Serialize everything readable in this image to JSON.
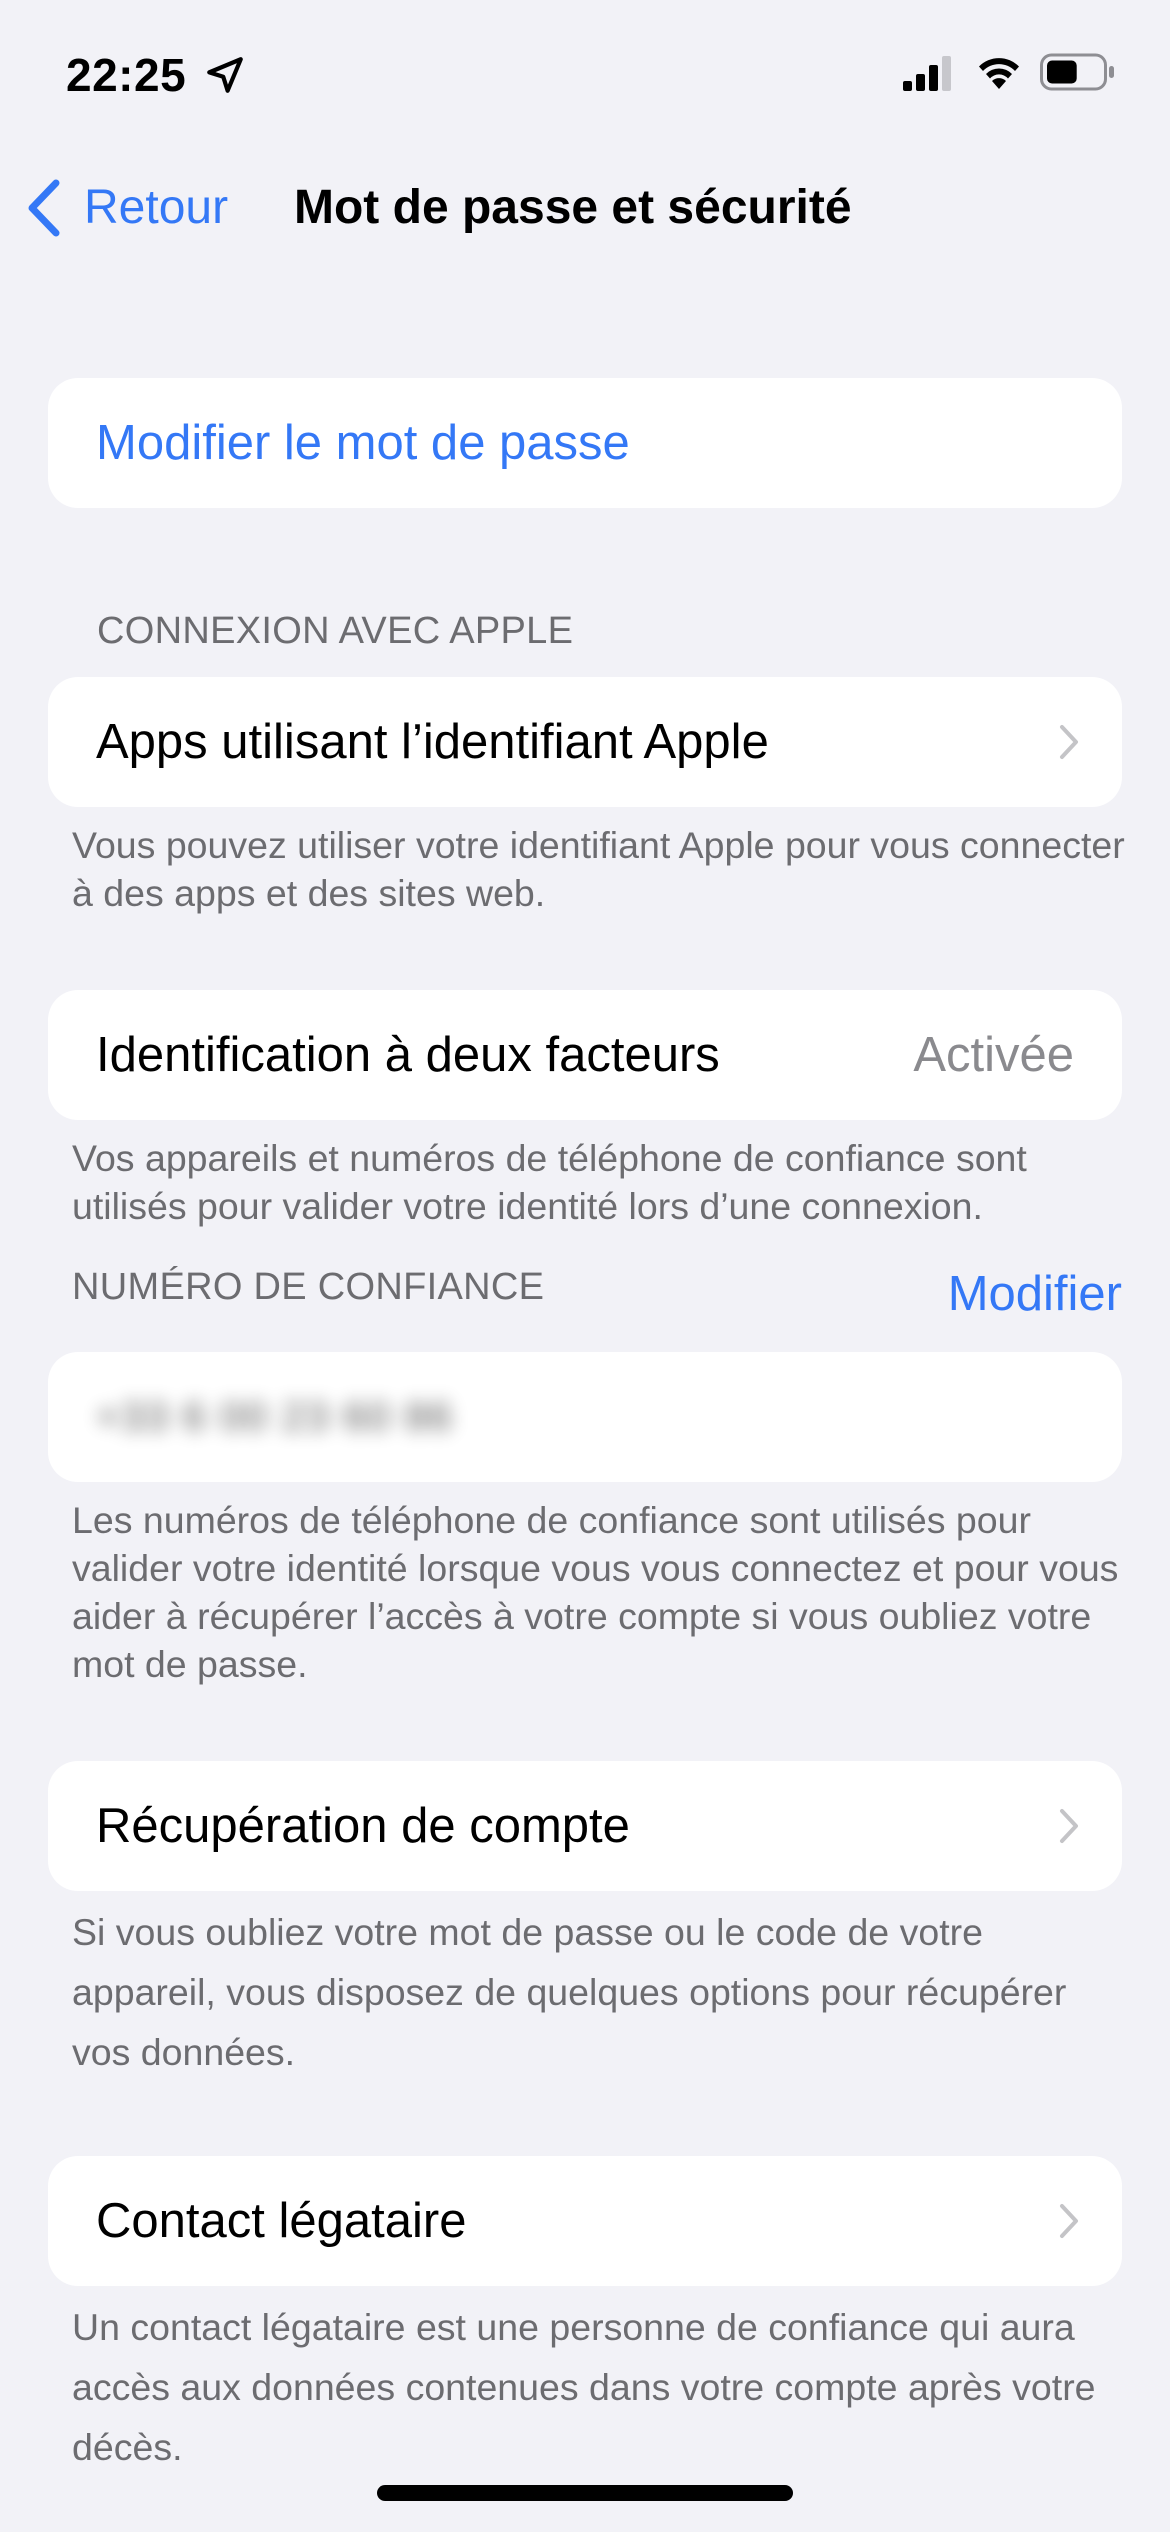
{
  "status_bar": {
    "time": "22:25",
    "icons": [
      "location-arrow-icon",
      "signal-icon",
      "wifi-icon",
      "battery-icon"
    ],
    "battery_level": 0.55
  },
  "nav": {
    "back_label": "Retour",
    "title": "Mot de passe et sécurité"
  },
  "change_password": {
    "label": "Modifier le mot de passe"
  },
  "sign_in_with_apple": {
    "header": "CONNEXION AVEC APPLE",
    "row_label": "Apps utilisant l’identifiant Apple",
    "footer": "Vous pouvez utiliser votre identifiant Apple pour vous connecter à des apps et des sites web."
  },
  "two_factor": {
    "label": "Identification à deux facteurs",
    "value": "Activée",
    "footer": "Vos appareils et numéros de téléphone de confiance sont utilisés pour valider votre identité lors d’une connexion."
  },
  "trusted_number": {
    "header": "NUMÉRO DE CONFIANCE",
    "edit_label": "Modifier",
    "number": "+33 6 00 23 60 86",
    "footer": "Les numéros de téléphone de confiance sont utilisés pour valider votre identité lorsque vous vous connectez et pour vous aider à récupérer l’accès à votre compte si vous oubliez votre mot de passe."
  },
  "account_recovery": {
    "label": "Récupération de compte",
    "footer": "Si vous oubliez votre mot de passe ou le code de votre appareil, vous disposez de quelques options pour récupérer vos données."
  },
  "legacy_contact": {
    "label": "Contact légataire",
    "footer": "Un contact légataire est une personne de confiance qui aura accès aux données contenues dans votre compte après votre décès."
  },
  "colors": {
    "accent": "#3478f6",
    "background": "#f2f2f7",
    "secondary_text": "#6c6c70"
  }
}
